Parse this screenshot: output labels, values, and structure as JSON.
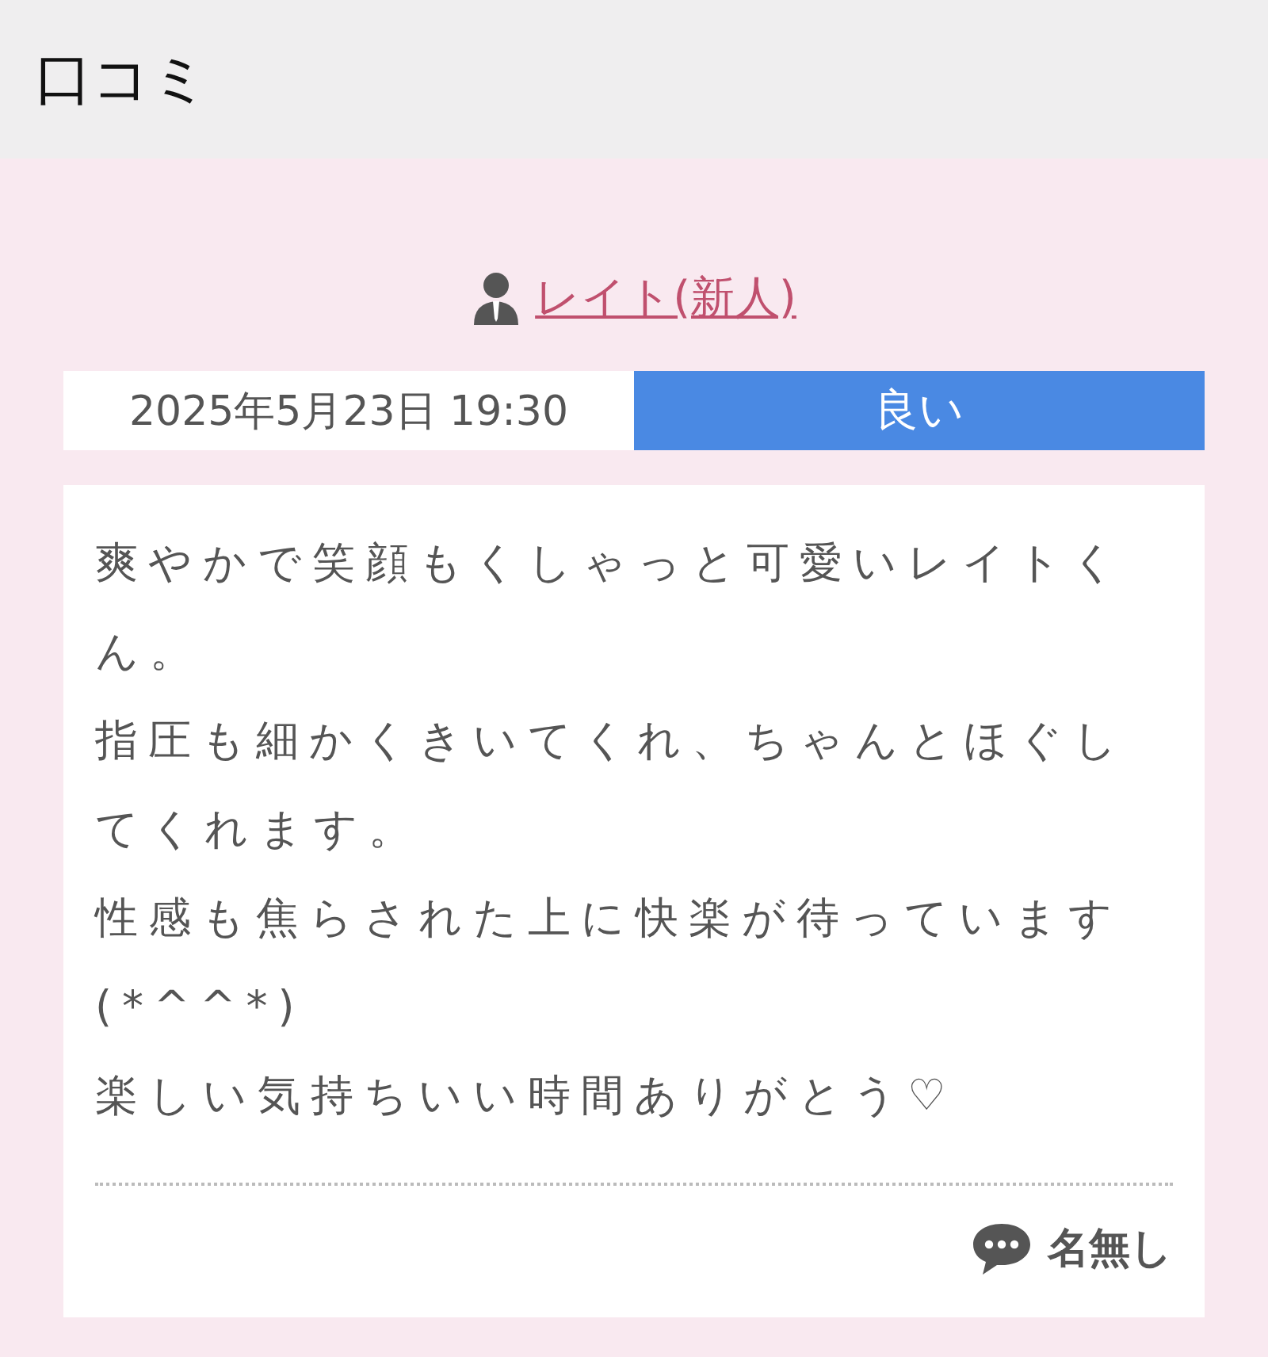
{
  "header": {
    "title": "口コミ"
  },
  "review": {
    "staff": "レイト(新人)",
    "date": "2025年5月23日 19:30",
    "rating": "良い",
    "paragraphs": [
      "爽やかで笑顔もくしゃっと可愛いレイトくん。",
      "指圧も細かくきいてくれ、ちゃんとほぐしてくれます。",
      "性感も焦らされた上に快楽が待っています(*^^*)",
      "楽しい気持ちいい時間ありがとう♡"
    ],
    "author": "名無し"
  }
}
